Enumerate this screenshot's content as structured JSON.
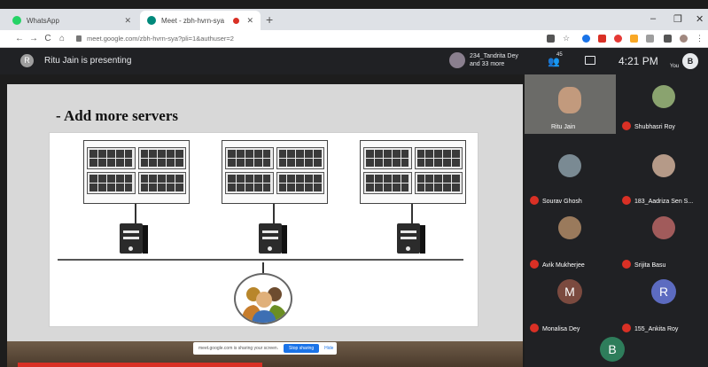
{
  "browser": {
    "tabs": [
      {
        "label": "WhatsApp",
        "active": false
      },
      {
        "label": "Meet - zbh-hvrn-sya",
        "active": true
      }
    ],
    "new_tab": "+",
    "window_controls": {
      "minimize": "–",
      "maximize": "❐",
      "close": "✕"
    },
    "nav": {
      "back": "←",
      "forward": "→",
      "reload": "C",
      "home": "⌂"
    },
    "url": "meet.google.com/zbh-hvrn-sya?pli=1&authuser=2"
  },
  "meet": {
    "presenter_initial": "R",
    "presenter_text": "Ritu Jain is presenting",
    "participants_summary": [
      "234_Tandrita Dey",
      "and 33 more"
    ],
    "people_count": "45",
    "clock": "4:21 PM",
    "you_label": "You",
    "self_initial": "B"
  },
  "slide": {
    "title": "- Add more servers"
  },
  "share_bar": {
    "text": "meet.google.com is sharing your screen.",
    "stop": "Stop sharing",
    "hide": "Hide"
  },
  "participants": [
    {
      "name": "Ritu Jain"
    },
    {
      "name": "Shubhasri Roy"
    },
    {
      "name": "Sourav Ghosh"
    },
    {
      "name": "183_Aadriza Sen S..."
    },
    {
      "name": "Avik Mukherjee"
    },
    {
      "name": "Srijita Basu"
    },
    {
      "name": "Monalisa Dey",
      "initial": "M"
    },
    {
      "name": "155_Ankita Roy",
      "initial": "R"
    },
    {
      "initial": "B"
    }
  ],
  "colors": {
    "meet_dark": "#202124",
    "tile_bg": "#3c4043",
    "mic_off": "#d93025",
    "accent_blue": "#1a73e8",
    "avatar_m": "#7b4a3f",
    "avatar_r": "#5c6bc0",
    "avatar_b": "#2e7d5b"
  }
}
